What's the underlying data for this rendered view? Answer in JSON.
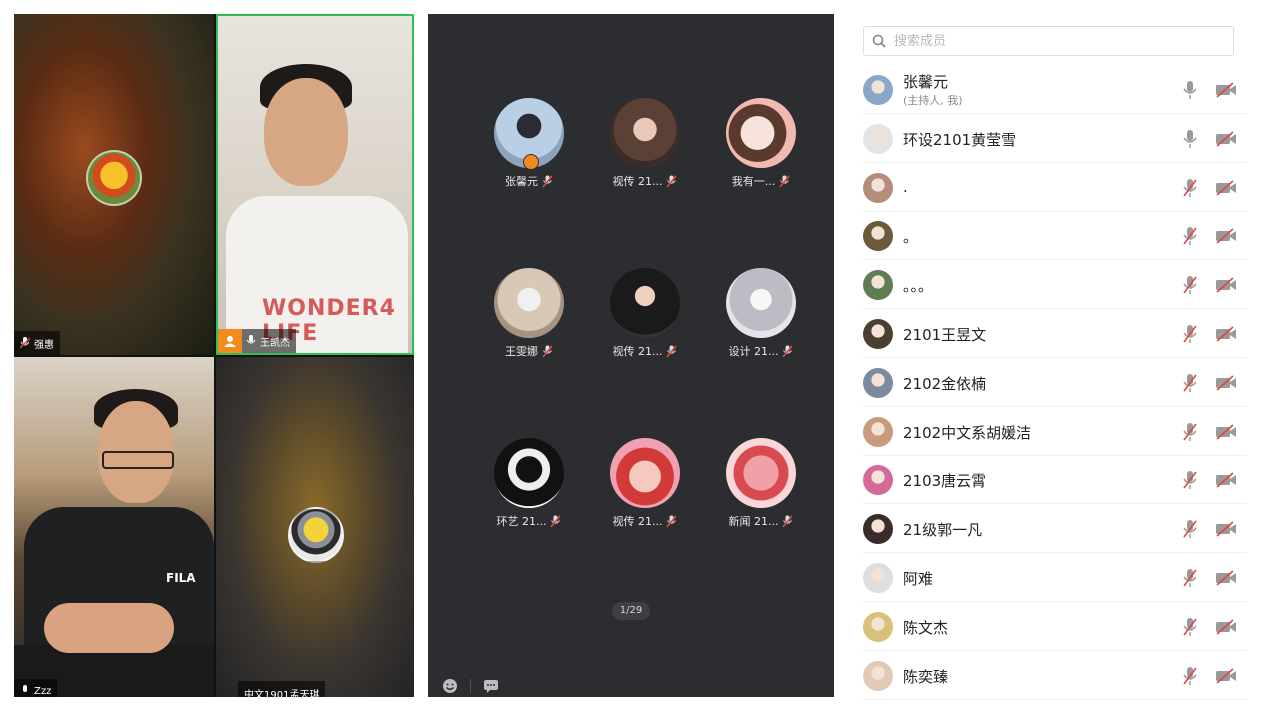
{
  "video_tiles": [
    {
      "name": "强惠",
      "mic_muted": true
    },
    {
      "name": "王凯杰",
      "mic_muted": false,
      "is_host_tagged": true,
      "shirt_text": "WONDER4 LIFE"
    },
    {
      "name": "Zzz",
      "mic_muted": false,
      "logo_text": "FILA"
    },
    {
      "name": "中文1901孟天琪",
      "mic_muted": true
    }
  ],
  "gallery": {
    "items": [
      {
        "label": "张馨元",
        "host": true
      },
      {
        "label": "视传 21...",
        "host": false
      },
      {
        "label": "我有一...",
        "host": false
      },
      {
        "label": "王雯娜",
        "host": false
      },
      {
        "label": "视传 21...",
        "host": false
      },
      {
        "label": "设计 21...",
        "host": false
      },
      {
        "label": "环艺 21...",
        "host": false
      },
      {
        "label": "视传 21...",
        "host": false
      },
      {
        "label": "新闻 21...",
        "host": false
      }
    ],
    "page_indicator": "1/29"
  },
  "members": {
    "search_placeholder": "搜索成员",
    "list": [
      {
        "name": "张馨元",
        "sub": "(主持人, 我)",
        "mic": "on",
        "color": "#8aa6c8"
      },
      {
        "name": "环设2101黄莹雪",
        "sub": "",
        "mic": "on",
        "color": "#e4e4e4"
      },
      {
        "name": ".",
        "sub": "",
        "mic": "off",
        "color": "#b48e7a"
      },
      {
        "name": "。",
        "sub": "",
        "mic": "off",
        "color": "#6b5a3e"
      },
      {
        "name": "。。。",
        "sub": "",
        "mic": "off",
        "color": "#5e7d52"
      },
      {
        "name": "2101王昱文",
        "sub": "",
        "mic": "off",
        "color": "#4a4032"
      },
      {
        "name": "2102金依楠",
        "sub": "",
        "mic": "off",
        "color": "#7c8aa0"
      },
      {
        "name": "2102中文系胡媛洁",
        "sub": "",
        "mic": "off",
        "color": "#c89a7e"
      },
      {
        "name": "2103唐云霄",
        "sub": "",
        "mic": "off",
        "color": "#d46a9a"
      },
      {
        "name": "21级郭一凡",
        "sub": "",
        "mic": "off",
        "color": "#3a2c2a"
      },
      {
        "name": "阿难",
        "sub": "",
        "mic": "off",
        "color": "#dedede"
      },
      {
        "name": "陈文杰",
        "sub": "",
        "mic": "off",
        "color": "#d8c27a"
      },
      {
        "name": "陈奕臻",
        "sub": "",
        "mic": "off",
        "color": "#e2cbb6"
      }
    ]
  },
  "colors": {
    "speaking_border": "#2fbf55",
    "host_badge": "#f28a1e",
    "gallery_bg": "#2c2d30",
    "muted_red": "#e04545"
  },
  "icons": {
    "search": "search-icon",
    "mic_on": "mic-icon",
    "mic_off": "mic-muted-icon",
    "camera_off": "camera-off-icon",
    "emoji": "emoji-icon",
    "chat": "chat-icon"
  }
}
